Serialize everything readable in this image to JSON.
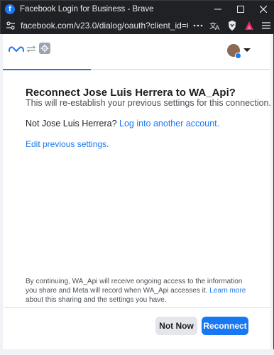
{
  "window": {
    "title": "Facebook Login for Business - Brave",
    "url": "facebook.com/v23.0/dialog/oauth?client_id=6073195...",
    "controls": [
      "minimize-icon",
      "maximize-icon",
      "close-icon"
    ]
  },
  "dialog": {
    "progress_fraction": 0.33,
    "heading": "Reconnect Jose Luis Herrera to WA_Api?",
    "subheading": "This will re-establish your previous settings for this connection.",
    "not_user_prefix": "Not Jose Luis Herrera?",
    "not_user_link": "Log into another account.",
    "edit_link": "Edit previous settings.",
    "disclaimer_part1": "By continuing, WA_Api will receive ongoing access to the information you share and Meta will record when WA_Api accesses it.",
    "disclaimer_link": "Learn more",
    "disclaimer_part2": "about this sharing and the settings you have.",
    "not_now_label": "Not Now",
    "reconnect_label": "Reconnect"
  },
  "colors": {
    "accent": "#1877f2",
    "title_bar": "#202124",
    "secondary_button": "#e4e6eb"
  }
}
